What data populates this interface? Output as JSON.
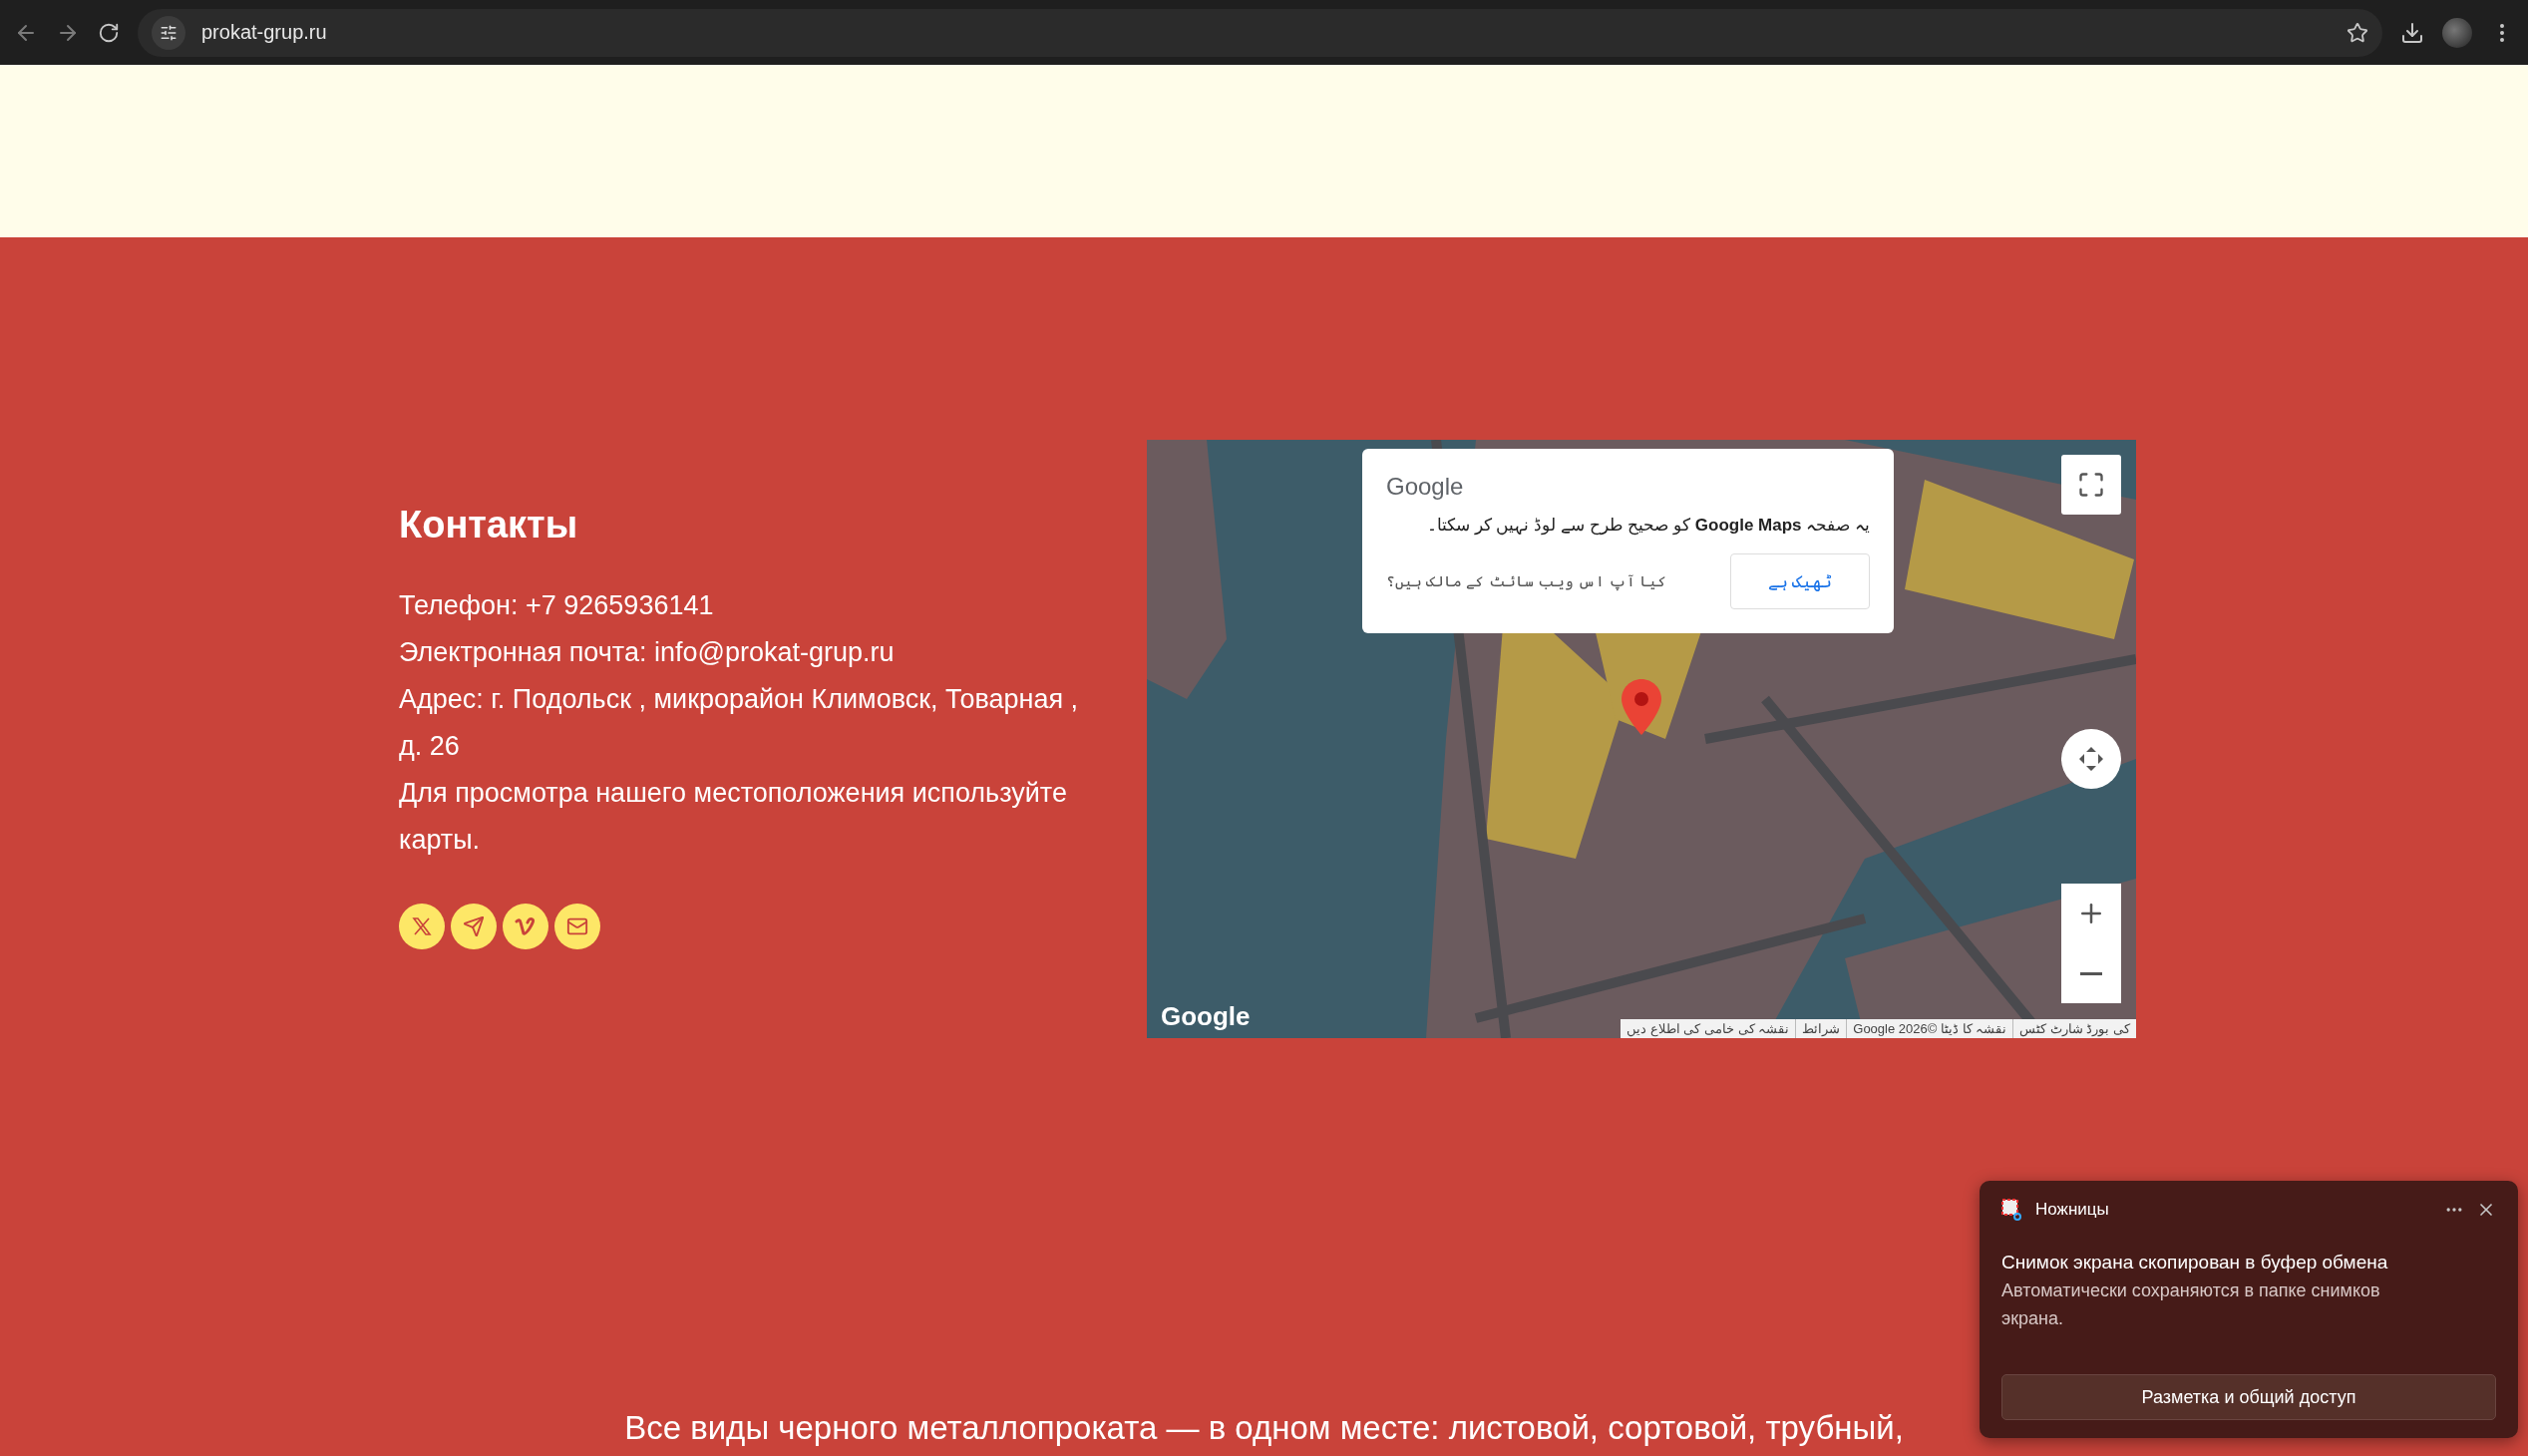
{
  "browser": {
    "url": "prokat-grup.ru"
  },
  "contacts": {
    "title": "Контакты",
    "lines": [
      "Телефон: +7 9265936141",
      "Электронная почта: info@prokat-grup.ru",
      "Адрес: г. Подольск , микрорайон Климовск, Товарная , д. 26",
      "Для просмотра нашего местоположения используйте карты."
    ]
  },
  "map": {
    "dialog": {
      "brand": "Google",
      "message": "یہ صفحہ **Google Maps** کو صحیح طرح سے لوڈ نہیں کر سکتا۔",
      "owner_question": "کیا آپ اس ویب سائٹ کے مالک ہیں؟",
      "ok_button": "ٹھیک ہے"
    },
    "logo": "Google",
    "attribution": [
      "کی بورڈ شارٹ کٹس",
      "نقشہ کا ڈیٹا ©2026 Google",
      "شرائط",
      "نقشہ کی خامی کی اطلاع دیں"
    ]
  },
  "tagline": "Все виды черного металлопроката — в одном месте: листовой, сортовой, трубный,",
  "notification": {
    "app": "Ножницы",
    "title": "Снимок экрана скопирован в буфер обмена",
    "body": "Автоматически сохраняются в папке снимков экрана.",
    "action": "Разметка и общий доступ"
  }
}
